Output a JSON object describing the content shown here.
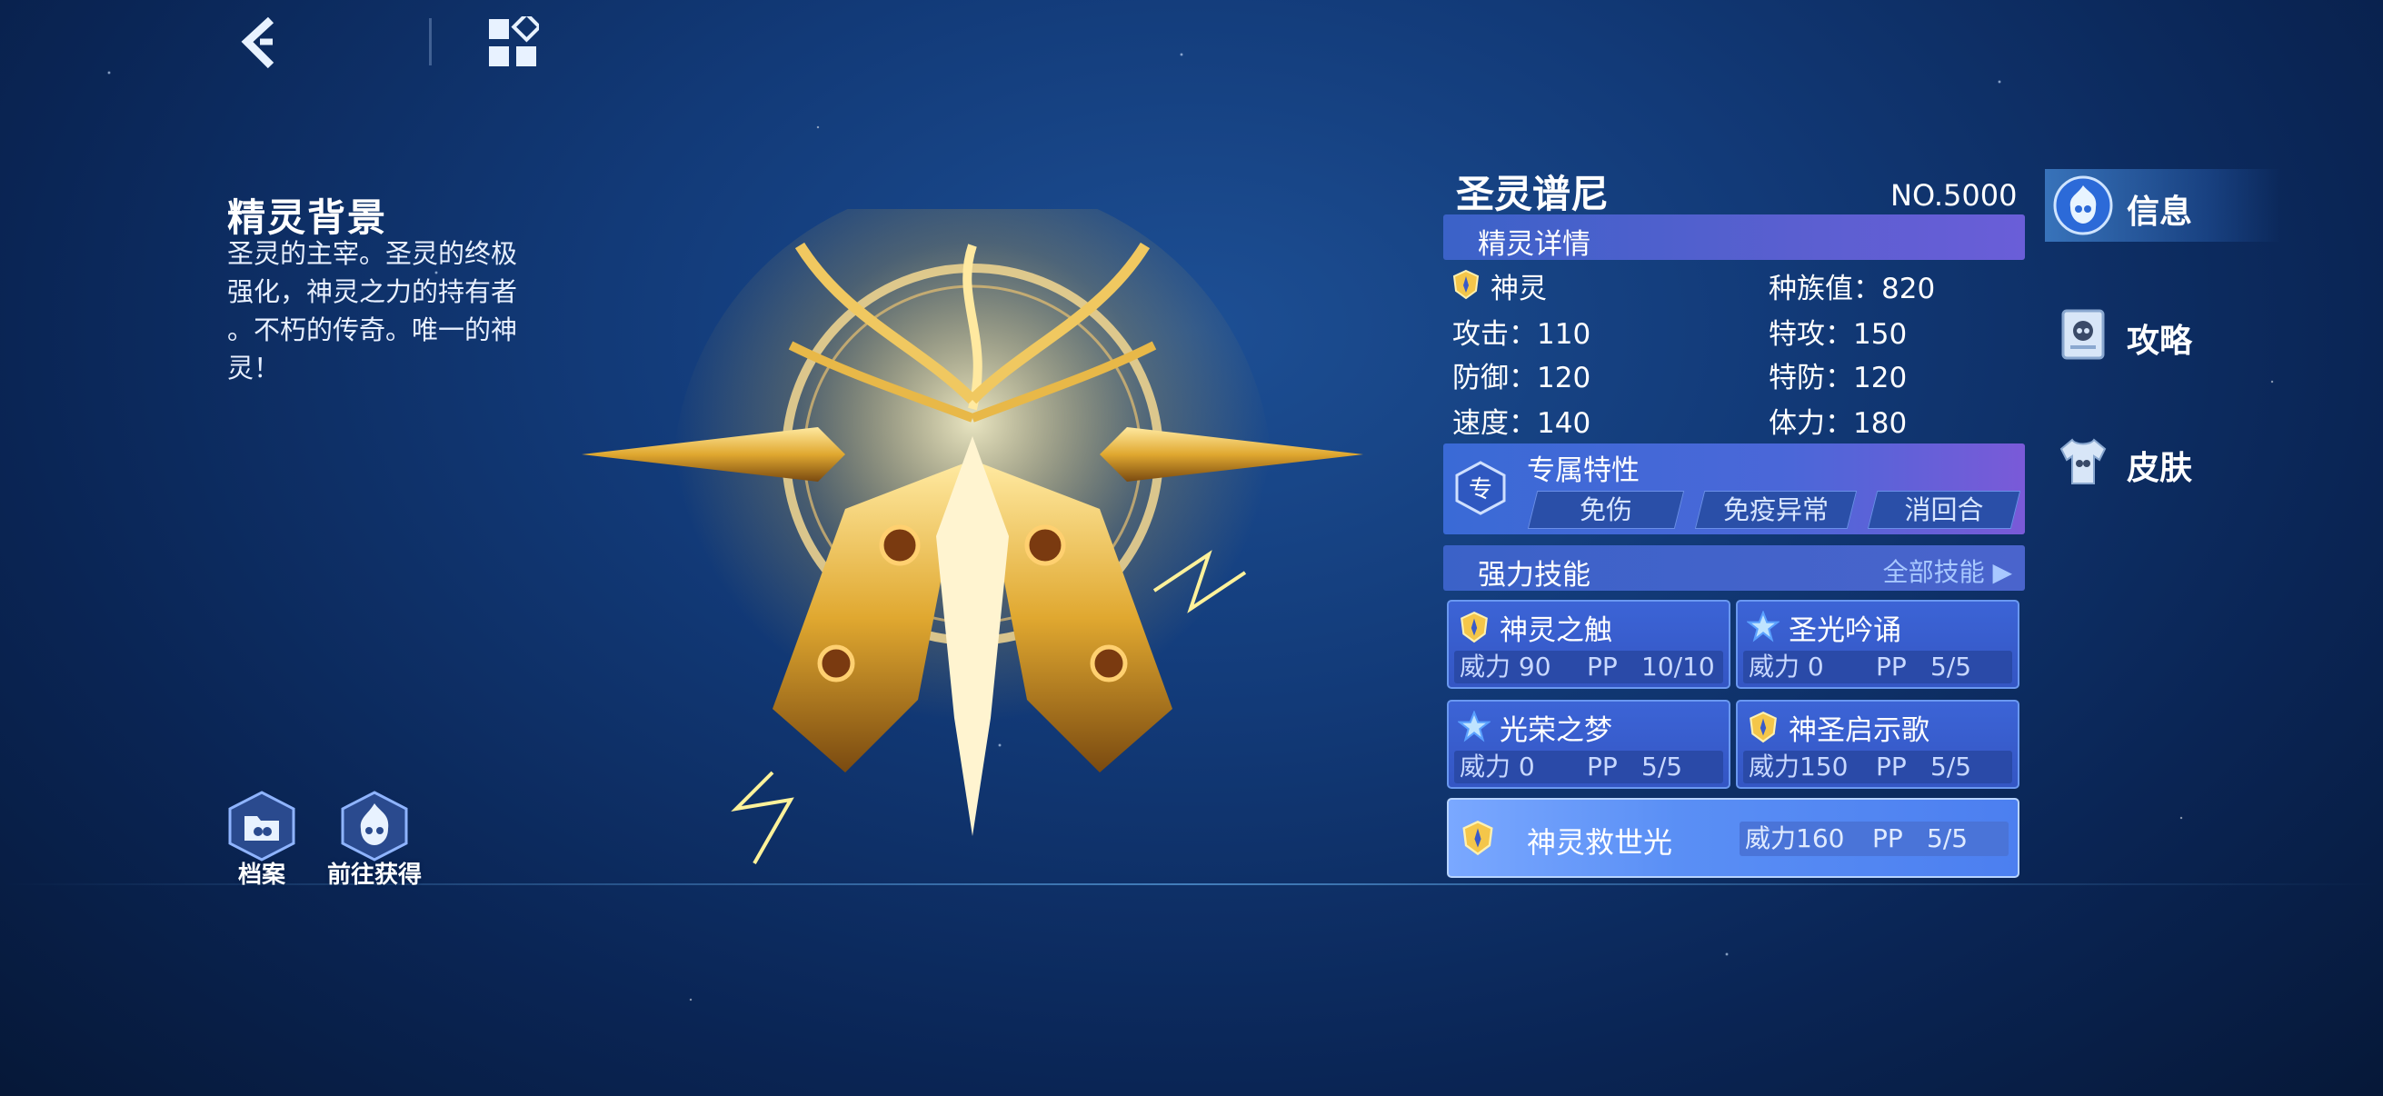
{
  "nav": {
    "back_icon": "back-chevron-icon",
    "menu_icon": "grid-menu-icon"
  },
  "background": {
    "title": "精灵背景",
    "lines": [
      "圣灵的主宰。圣灵的终极",
      "强化，神灵之力的持有者",
      "。不朽的传奇。唯一的神",
      "灵！"
    ]
  },
  "bottom_buttons": [
    {
      "label": "档案",
      "icon": "archive-folder-icon"
    },
    {
      "label": "前往获得",
      "icon": "flame-mascot-icon"
    }
  ],
  "creature": {
    "icon": "golden-spirit-artwork"
  },
  "pet": {
    "name": "圣灵谱尼",
    "number": "NO.5000"
  },
  "details": {
    "title": "精灵详情",
    "type": "神灵",
    "race_label": "种族值：820",
    "stats": [
      {
        "label": "攻击：110"
      },
      {
        "label": "特攻：150"
      },
      {
        "label": "防御：120"
      },
      {
        "label": "特防：120"
      },
      {
        "label": "速度：140"
      },
      {
        "label": "体力：180"
      }
    ]
  },
  "traits": {
    "title": "专属特性",
    "badge": "专",
    "items": [
      "免伤",
      "免疫异常",
      "消回合"
    ]
  },
  "skills": {
    "title": "强力技能",
    "all_label": "全部技能 ▶",
    "items": [
      {
        "name": "神灵之触",
        "power": "威力 90",
        "pp_label": "PP",
        "pp": "10/10",
        "icon": "divine-type-icon"
      },
      {
        "name": "圣光吟诵",
        "power": "威力 0",
        "pp_label": "PP",
        "pp": "5/5",
        "icon": "holy-star-icon"
      },
      {
        "name": "光荣之梦",
        "power": "威力 0",
        "pp_label": "PP",
        "pp": "5/5",
        "icon": "holy-star-icon"
      },
      {
        "name": "神圣启示歌",
        "power": "威力150",
        "pp_label": "PP",
        "pp": "5/5",
        "icon": "divine-type-icon"
      }
    ],
    "ultimate": {
      "name": "神灵救世光",
      "power": "威力160",
      "pp_label": "PP",
      "pp": "5/5",
      "icon": "divine-type-icon"
    }
  },
  "tabs": [
    {
      "label": "信息",
      "icon": "flame-face-icon",
      "active": true
    },
    {
      "label": "攻略",
      "icon": "guide-book-icon",
      "active": false
    },
    {
      "label": "皮肤",
      "icon": "shirt-icon",
      "active": false
    }
  ]
}
